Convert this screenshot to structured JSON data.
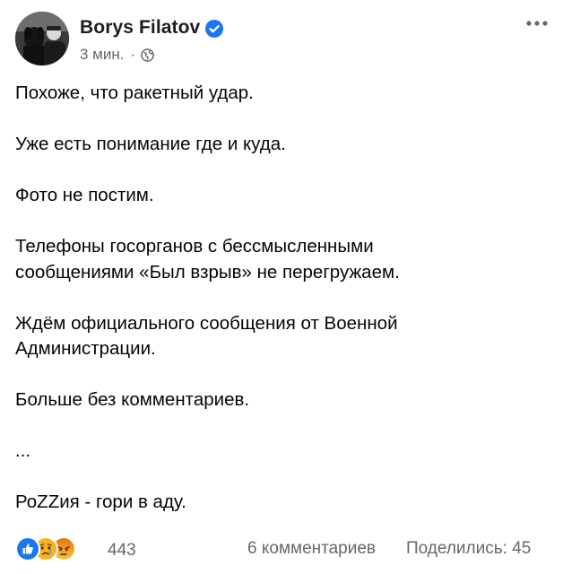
{
  "post": {
    "author": "Borys Filatov",
    "time": "3 мин.",
    "separator": "·",
    "privacy_icon": "globe-icon",
    "verified_icon": "verified-badge-icon",
    "more_icon": "more-options-icon",
    "paragraphs": [
      [
        "Похоже, что ракетный удар."
      ],
      [
        "Уже есть понимание где и куда."
      ],
      [
        "Фото не постим."
      ],
      [
        "Телефоны госорганов с бессмысленными",
        "сообщениями «Был взрыв» не перегружаем."
      ],
      [
        "Ждём официального сообщения от Военной",
        "Администрации."
      ],
      [
        "Больше без комментариев."
      ],
      [
        "..."
      ],
      [
        "РоZZия - гори в аду."
      ]
    ]
  },
  "footer": {
    "reactions": [
      "like",
      "sad",
      "angry"
    ],
    "reaction_count": "443",
    "comments": "6 комментариев",
    "shares": "Поделились: 45"
  },
  "colors": {
    "verified": "#1877f2",
    "like": "#1877f2",
    "sad_angry": "#f7b125",
    "angry": "#e9710f",
    "secondary_text": "#65676b"
  }
}
